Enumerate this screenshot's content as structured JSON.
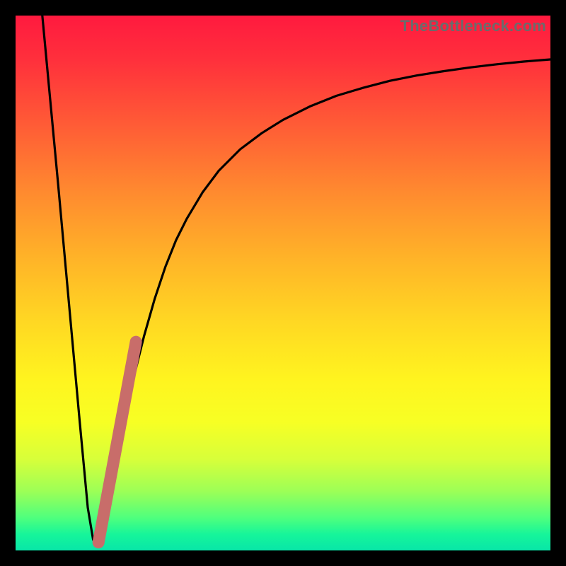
{
  "watermark": "TheBottleneck.com",
  "colors": {
    "frame": "#000000",
    "curve": "#000000",
    "marker": "#c86d6a",
    "gradient_top": "#ff1a3f",
    "gradient_bottom": "#08e6a8"
  },
  "chart_data": {
    "type": "line",
    "title": "",
    "xlabel": "",
    "ylabel": "",
    "xlim": [
      0,
      100
    ],
    "ylim": [
      0,
      100
    ],
    "grid": false,
    "series": [
      {
        "name": "bottleneck-curve",
        "x": [
          5,
          8,
          10,
          12,
          13.5,
          14.5,
          16,
          18,
          20,
          22,
          24,
          26,
          28,
          30,
          32,
          35,
          38,
          42,
          46,
          50,
          55,
          60,
          65,
          70,
          75,
          80,
          85,
          90,
          95,
          100
        ],
        "y": [
          100,
          68,
          46,
          24,
          8,
          2,
          2,
          12,
          22,
          32,
          40,
          47,
          53,
          58,
          62,
          67,
          71,
          75,
          78,
          80.5,
          83,
          85,
          86.5,
          87.8,
          88.8,
          89.6,
          90.3,
          90.9,
          91.4,
          91.8
        ]
      }
    ],
    "marker_segment": {
      "x": [
        15.5,
        22.5
      ],
      "y": [
        1.5,
        39
      ]
    }
  }
}
